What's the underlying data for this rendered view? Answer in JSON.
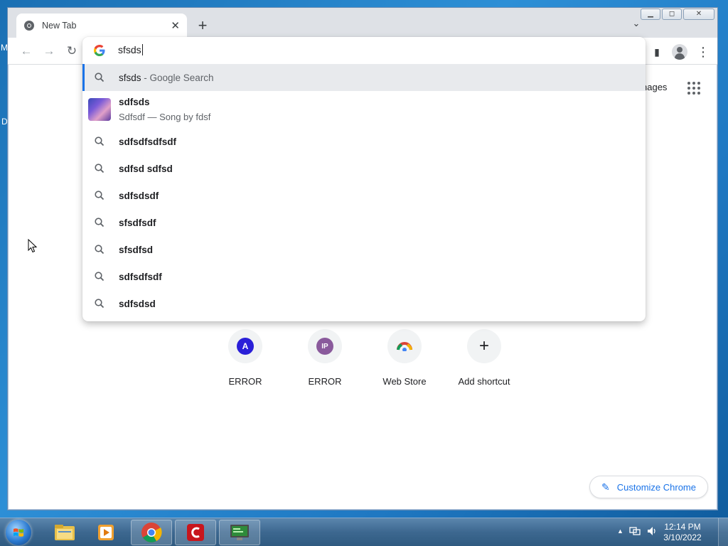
{
  "desktop": {
    "left_edge_letter_top": "M",
    "left_edge_letter_mid": "D"
  },
  "browser": {
    "tab": {
      "title": "New Tab",
      "close_glyph": "✕"
    },
    "new_tab_glyph": "+",
    "tab_search_glyph": "⌄",
    "window_controls": {
      "minimize": "▁",
      "maximize": "◻",
      "close": "✕"
    }
  },
  "toolbar": {
    "back": "←",
    "forward": "→",
    "reload": "↻",
    "side_panel": "▮",
    "menu": "⋮"
  },
  "omnibox": {
    "query": "sfsds",
    "suggestions": [
      {
        "type": "search",
        "main": "sfsds",
        "secondary": " - Google Search",
        "selected": true
      },
      {
        "type": "rich",
        "title": "sdfsds",
        "subtitle": "Sdfsdf — Song by fdsf"
      },
      {
        "type": "search",
        "main": "sdfsdfsdfsdf"
      },
      {
        "type": "search",
        "main": "sdfsd sdfsd"
      },
      {
        "type": "search",
        "main": "sdfsdsdf"
      },
      {
        "type": "search",
        "main": "sfsdfsdf"
      },
      {
        "type": "search",
        "main": "sfsdfsd"
      },
      {
        "type": "search",
        "main": "sdfsdfsdf"
      },
      {
        "type": "search",
        "main": "sdfsdsd"
      }
    ]
  },
  "ntp": {
    "images_label": "nages",
    "shortcuts": [
      {
        "label": "ERROR",
        "initial": "A",
        "color": "#2a1fd8"
      },
      {
        "label": "ERROR",
        "initial": "IP",
        "color": "#8a5a9c"
      },
      {
        "label": "Web Store",
        "initial": "",
        "color": ""
      },
      {
        "label": "Add shortcut",
        "initial": "+",
        "color": ""
      }
    ],
    "customize_label": "Customize Chrome"
  },
  "taskbar": {
    "clock_time": "12:14 PM",
    "clock_date": "3/10/2022",
    "tray_arrow": "▲"
  }
}
